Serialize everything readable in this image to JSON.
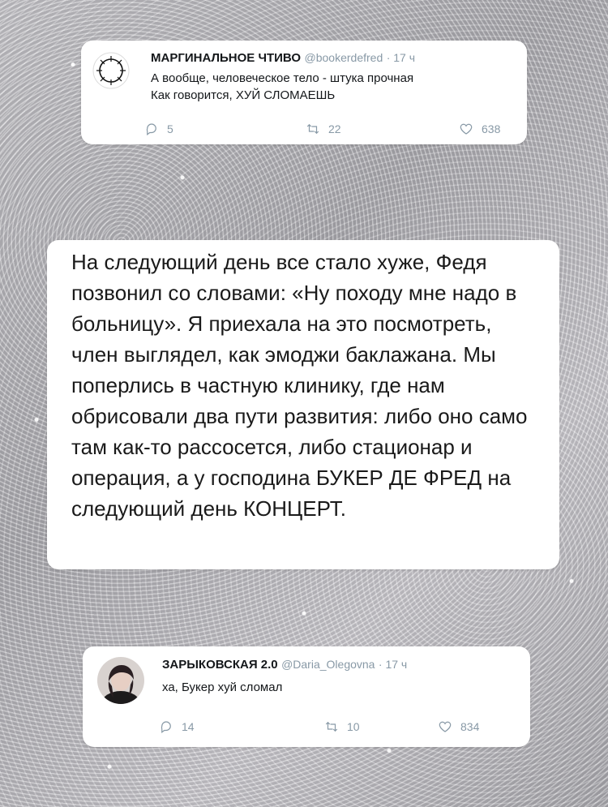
{
  "tweet_top": {
    "avatar_icon": "barbed-wire-crown-icon",
    "name": "МАРГИНАЛЬНОЕ ЧТИВО",
    "handle": "@bookerdefred",
    "time": "· 17 ч",
    "lines": [
      "А вообще, человеческое тело - штука прочная",
      "Как говорится, ХУЙ СЛОМАЕШЬ"
    ],
    "replies": "5",
    "retweets": "22",
    "likes": "638"
  },
  "story": {
    "text": "На следующий день все стало хуже, Федя позвонил со словами: «Ну походу мне надо в больницу». Я приехала на это посмотреть, член выглядел, как эмоджи баклажана. Мы поперлись в частную клинику, где нам обрисовали два пути развития: либо оно само там как-то рассосется, либо стационар и операция, а у господина БУКЕР ДЕ ФРЕД на следующий день КОНЦЕРТ."
  },
  "tweet_bottom": {
    "avatar_icon": "user-photo-avatar",
    "name": "ЗАРЫКОВСКАЯ 2.0",
    "handle": "@Daria_Olegovna",
    "time": "· 17 ч",
    "text": "ха, Букер хуй сломал",
    "replies": "14",
    "retweets": "10",
    "likes": "834"
  },
  "colors": {
    "card_bg": "#ffffff",
    "meta_gray": "#8899a6",
    "text_dark": "#14171a"
  }
}
